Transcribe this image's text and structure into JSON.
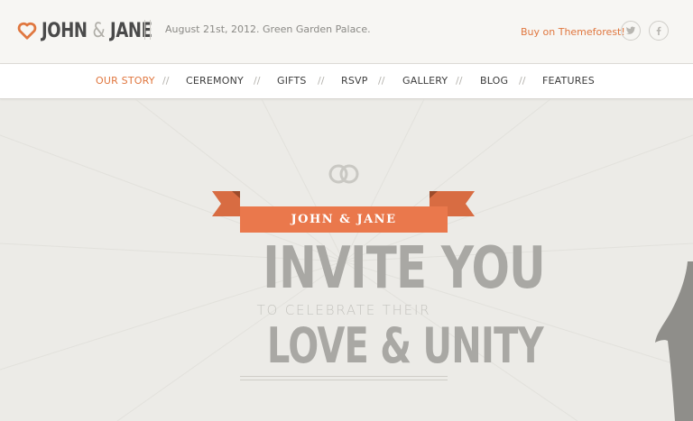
{
  "brand": {
    "name_first": "JOHN",
    "name_amp": "&",
    "name_second": "JANE",
    "accent": "#e0773f"
  },
  "header": {
    "tagline": "August 21st, 2012. Green Garden Palace.",
    "buy_label": "Buy on Themeforest!",
    "social": [
      "twitter-icon",
      "facebook-icon"
    ]
  },
  "nav": {
    "items": [
      {
        "label": "OUR STORY",
        "active": true
      },
      {
        "label": "CEREMONY"
      },
      {
        "label": "GIFTS"
      },
      {
        "label": "RSVP"
      },
      {
        "label": "GALLERY"
      },
      {
        "label": "BLOG"
      },
      {
        "label": "FEATURES"
      }
    ],
    "separator": "//"
  },
  "hero": {
    "ribbon_text": "JOHN & JANE",
    "line1": "INVITE YOU",
    "line2": "TO CELEBRATE THEIR",
    "line3": "LOVE & UNITY",
    "ribbon_color": "#ea784c",
    "text_color": "#a9a8a4"
  }
}
